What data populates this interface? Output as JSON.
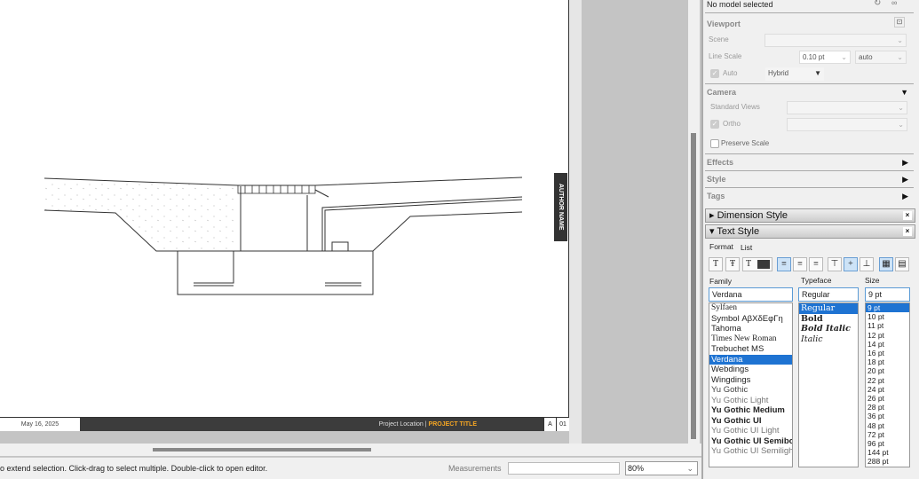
{
  "canvas": {
    "author": "AUTHOR NAME",
    "date": "May 16, 2025",
    "project_location": "Project Location",
    "project_title": "PROJECT TITLE",
    "revision": "A",
    "sheet": "01"
  },
  "status": {
    "message": "o extend selection. Click-drag to select multiple. Double-click to open editor.",
    "measurements_label": "Measurements",
    "zoom": "80%"
  },
  "panel": {
    "model": "No model selected",
    "viewport": {
      "title": "Viewport",
      "scene_label": "Scene",
      "line_scale_label": "Line Scale",
      "line_scale": "0.10 pt",
      "line_scale_mode": "auto",
      "auto_label": "Auto",
      "render_mode": "Hybrid"
    },
    "camera": {
      "title": "Camera",
      "standard_views_label": "Standard Views",
      "ortho_label": "Ortho",
      "preserve_scale_label": "Preserve Scale"
    },
    "effects": "Effects",
    "style": "Style",
    "tags": "Tags",
    "dimension_style": "Dimension Style",
    "text_style": {
      "title": "Text Style",
      "tabs": [
        "Format",
        "List"
      ],
      "family_label": "Family",
      "typeface_label": "Typeface",
      "size_label": "Size",
      "family": "Verdana",
      "typeface": "Regular",
      "size": "9 pt",
      "families": [
        "Sylfaen",
        "Symbol ΑβΧδΕφΓη",
        "Tahoma",
        "Times New Roman",
        "Trebuchet MS",
        "Verdana",
        "Webdings",
        "Wingdings",
        "Yu Gothic",
        "Yu Gothic Light",
        "Yu Gothic Medium",
        "Yu Gothic UI",
        "Yu Gothic UI Light",
        "Yu Gothic UI Semibold",
        "Yu Gothic UI Semilight"
      ],
      "typefaces": [
        "Regular",
        "Bold",
        "Bold Italic",
        "Italic"
      ],
      "sizes": [
        "9 pt",
        "10 pt",
        "11 pt",
        "12 pt",
        "14 pt",
        "16 pt",
        "18 pt",
        "20 pt",
        "22 pt",
        "24 pt",
        "26 pt",
        "28 pt",
        "36 pt",
        "48 pt",
        "72 pt",
        "96 pt",
        "144 pt",
        "288 pt"
      ]
    }
  }
}
